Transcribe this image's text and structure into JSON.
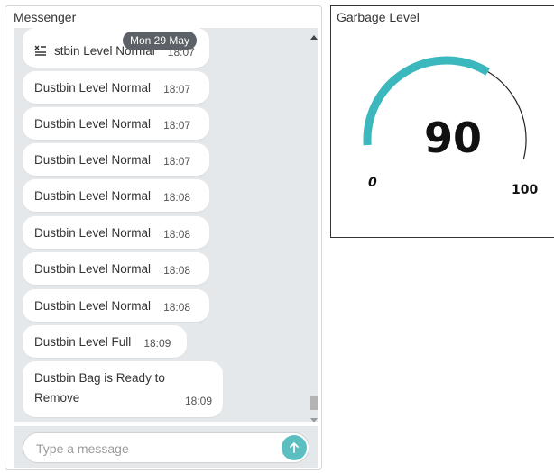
{
  "messenger": {
    "title": "Messenger",
    "date_pill": "Mon 29 May",
    "messages": [
      {
        "text": "stbin Level Normal",
        "time": "18:07"
      },
      {
        "text": "Dustbin Level Normal",
        "time": "18:07"
      },
      {
        "text": "Dustbin Level Normal",
        "time": "18:07"
      },
      {
        "text": "Dustbin Level Normal",
        "time": "18:07"
      },
      {
        "text": "Dustbin Level Normal",
        "time": "18:08"
      },
      {
        "text": "Dustbin Level Normal",
        "time": "18:08"
      },
      {
        "text": "Dustbin Level Normal",
        "time": "18:08"
      },
      {
        "text": "Dustbin Level Normal",
        "time": "18:08"
      },
      {
        "text": "Dustbin Level Full",
        "time": "18:09"
      },
      {
        "text": "Dustbin Bag is Ready to Remove",
        "time": "18:09"
      }
    ],
    "input": {
      "placeholder": "Type a message",
      "value": ""
    },
    "first_message_icon": "clear-all-icon",
    "send_icon": "arrow-up-icon"
  },
  "gauge": {
    "title": "Garbage Level",
    "value": "90",
    "min": "0",
    "max": "100",
    "fill_fraction": 0.9,
    "color": "#3bb8bd"
  }
}
